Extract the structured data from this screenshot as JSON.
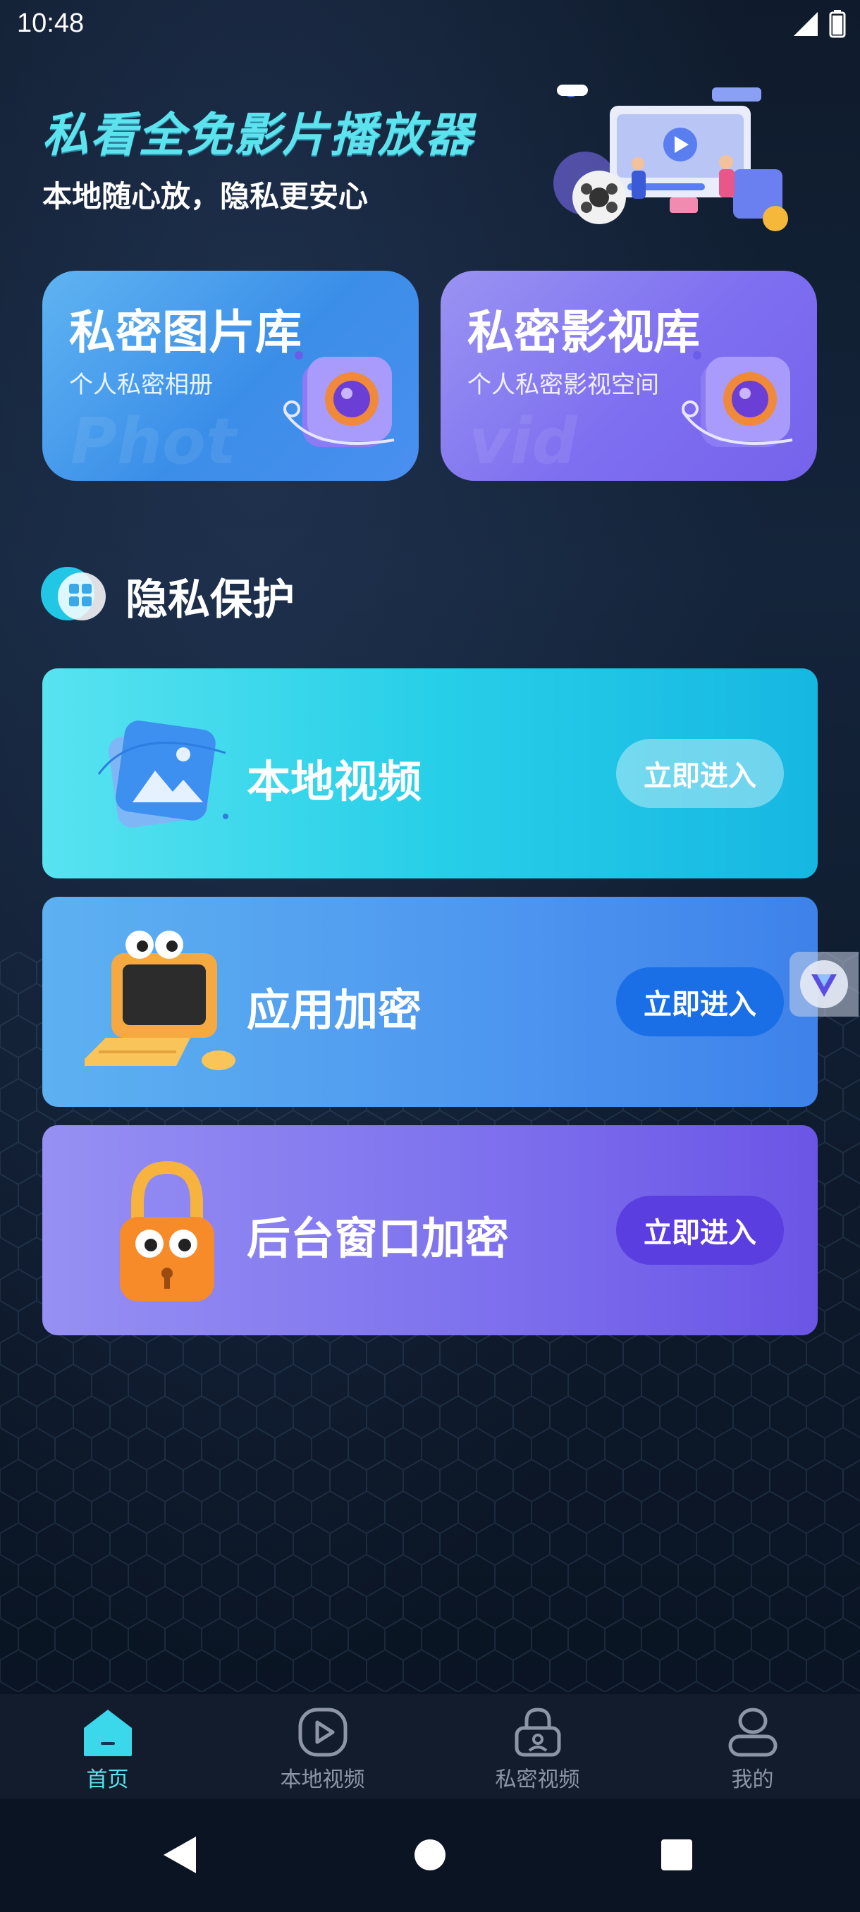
{
  "status_bar": {
    "time": "10:48"
  },
  "hero": {
    "title": "私看全免影片播放器",
    "subtitle": "本地随心放，隐私更安心"
  },
  "libraries": [
    {
      "title": "私密图片库",
      "subtitle": "个人私密相册",
      "watermark": "Phot"
    },
    {
      "title": "私密影视库",
      "subtitle": "个人私密影视空间",
      "watermark": "vid"
    }
  ],
  "section": {
    "title": "隐私保护"
  },
  "features": [
    {
      "label": "本地视频",
      "button": "立即进入"
    },
    {
      "label": "应用加密",
      "button": "立即进入"
    },
    {
      "label": "后台窗口加密",
      "button": "立即进入"
    }
  ],
  "bottom_nav": [
    {
      "label": "首页",
      "icon": "home-icon",
      "active": true
    },
    {
      "label": "本地视频",
      "icon": "play-circle-icon",
      "active": false
    },
    {
      "label": "私密视频",
      "icon": "lock-icon",
      "active": false
    },
    {
      "label": "我的",
      "icon": "person-icon",
      "active": false
    }
  ],
  "colors": {
    "accent": "#5de3ee",
    "nav_inactive": "#8d95a6",
    "background": "#0f1b2c"
  }
}
